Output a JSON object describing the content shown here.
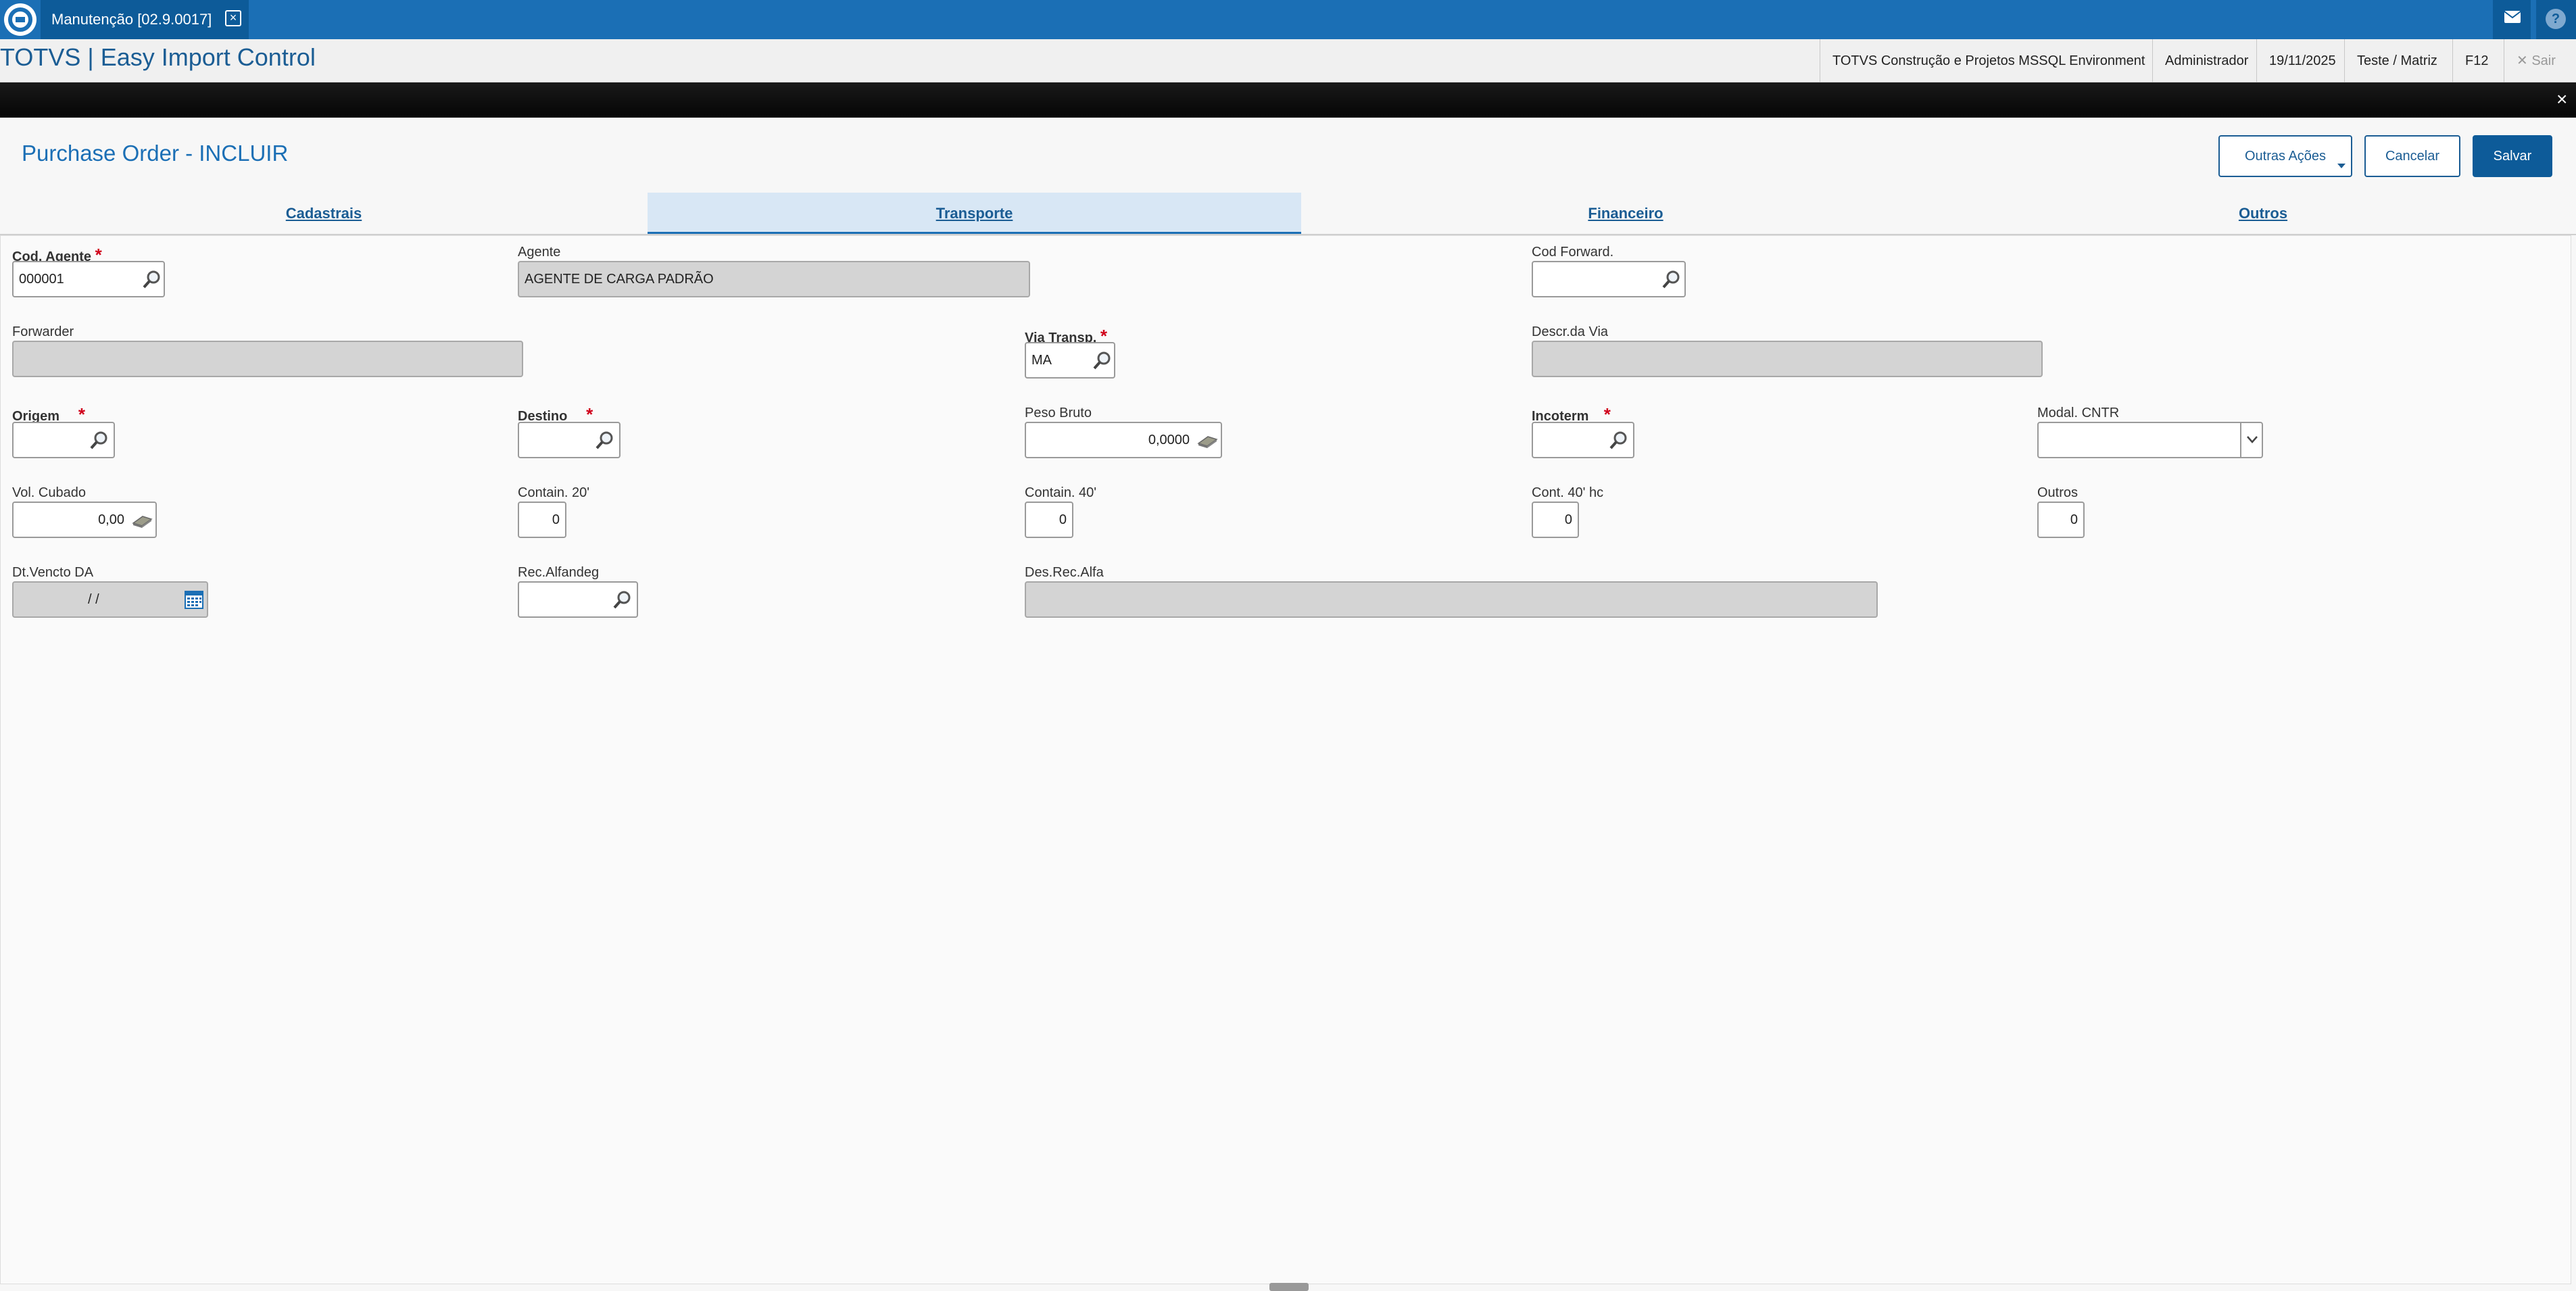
{
  "topbar": {
    "tab_label": "Manutenção [02.9.0017]",
    "tab_close": "×"
  },
  "header": {
    "app_title": "TOTVS | Easy Import Control",
    "environment": "TOTVS Construção e Projetos MSSQL Environment",
    "user": "Administrador",
    "date": "19/11/2025",
    "branch": "Teste / Matriz",
    "shortcut": "F12",
    "exit": "✕ Sair"
  },
  "page": {
    "title": "Purchase Order - INCLUIR",
    "close": "×"
  },
  "actions": {
    "other": "Outras Ações",
    "cancel": "Cancelar",
    "save": "Salvar"
  },
  "tabs": [
    {
      "label": "Cadastrais",
      "active": false
    },
    {
      "label": "Transporte",
      "active": true
    },
    {
      "label": "Financeiro",
      "active": false
    },
    {
      "label": "Outros",
      "active": false
    }
  ],
  "form": {
    "cod_agente": {
      "label": "Cod. Agente",
      "value": "000001",
      "required": "*"
    },
    "agente": {
      "label": "Agente",
      "value": "AGENTE DE CARGA PADRÃO"
    },
    "cod_forward": {
      "label": "Cod Forward.",
      "value": ""
    },
    "forwarder": {
      "label": "Forwarder",
      "value": ""
    },
    "via_transp": {
      "label": "Via Transp.",
      "value": "MA",
      "required": "*"
    },
    "descr_via": {
      "label": "Descr.da Via",
      "value": ""
    },
    "origem": {
      "label": "Origem",
      "value": "",
      "required": "*"
    },
    "destino": {
      "label": "Destino",
      "value": "",
      "required": "*"
    },
    "peso_bruto": {
      "label": "Peso Bruto",
      "value": "0,0000"
    },
    "incoterm": {
      "label": "Incoterm",
      "value": "",
      "required": "*"
    },
    "modal_cntr": {
      "label": "Modal. CNTR",
      "value": ""
    },
    "vol_cubado": {
      "label": "Vol. Cubado",
      "value": "0,00"
    },
    "contain_20": {
      "label": "Contain. 20'",
      "value": "0"
    },
    "contain_40": {
      "label": "Contain. 40'",
      "value": "0"
    },
    "cont_40hc": {
      "label": "Cont. 40' hc",
      "value": "0"
    },
    "outros": {
      "label": "Outros",
      "value": "0"
    },
    "dt_vencto": {
      "label": "Dt.Vencto DA",
      "value": "/ /"
    },
    "rec_alfandeg": {
      "label": "Rec.Alfandeg",
      "value": ""
    },
    "des_rec_alfa": {
      "label": "Des.Rec.Alfa",
      "value": ""
    }
  },
  "colors": {
    "brand_blue": "#1b6fb5",
    "dark_blue": "#0d5b99",
    "required_red": "#d0021b"
  },
  "icons": [
    "totvs-logo-icon",
    "close-icon",
    "mail-icon",
    "help-icon",
    "search-icon",
    "calculator-icon",
    "calendar-icon",
    "chevron-down-icon"
  ]
}
